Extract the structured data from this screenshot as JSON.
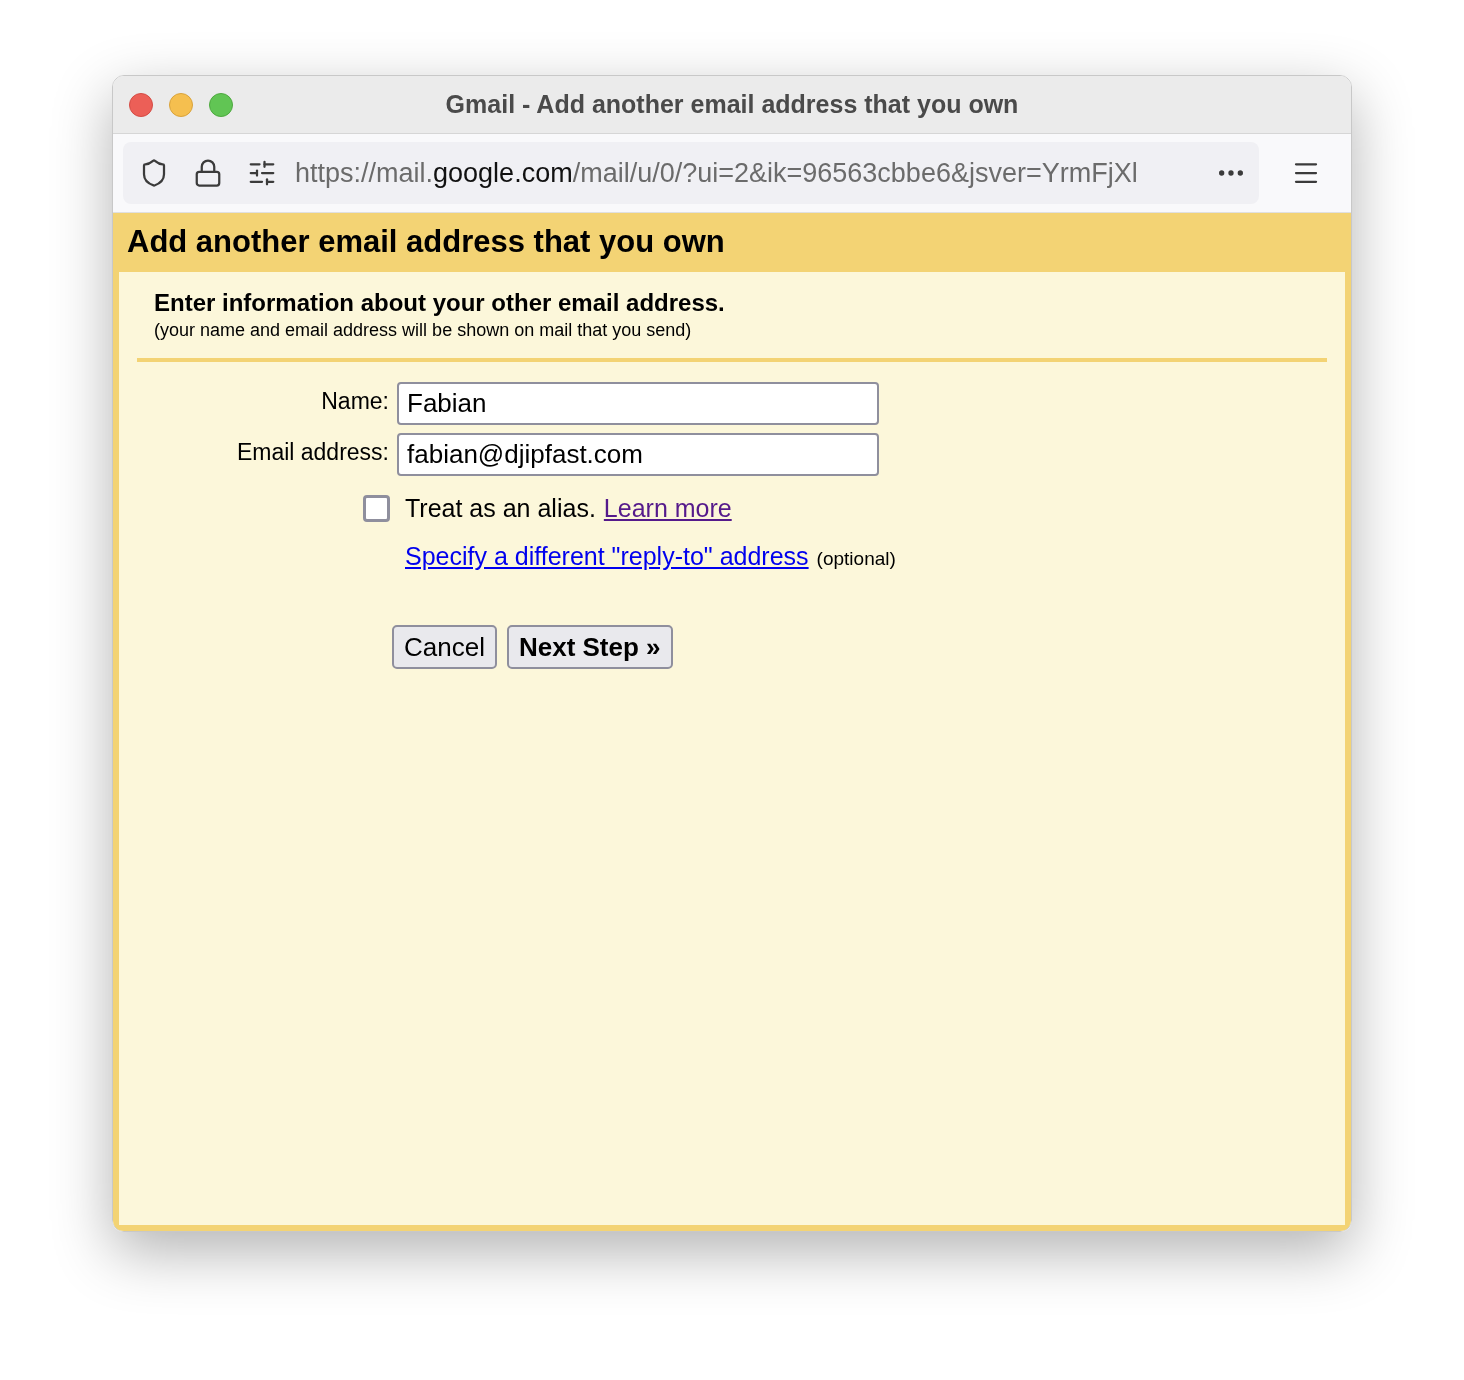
{
  "window": {
    "title": "Gmail - Add another email address that you own"
  },
  "address_bar": {
    "url_prefix": "https://mail.",
    "url_domain": "google.com",
    "url_path": "/mail/u/0/?ui=2&ik=96563cbbe6&jsver=YrmFjXl"
  },
  "dialog": {
    "title": "Add another email address that you own",
    "heading": "Enter information about your other email address.",
    "subheading": "(your name and email address will be shown on mail that you send)",
    "fields": [
      {
        "label": "Name:",
        "value": "Fabian"
      },
      {
        "label": "Email address:",
        "value": "fabian@djipfast.com"
      }
    ],
    "alias": {
      "checked": false,
      "label": "Treat as an alias.",
      "link": "Learn more"
    },
    "reply_to": {
      "link": "Specify a different \"reply-to\" address",
      "note": "(optional)"
    },
    "buttons": [
      {
        "label": "Cancel",
        "kind": "secondary"
      },
      {
        "label": "Next Step »",
        "kind": "primary"
      }
    ]
  }
}
